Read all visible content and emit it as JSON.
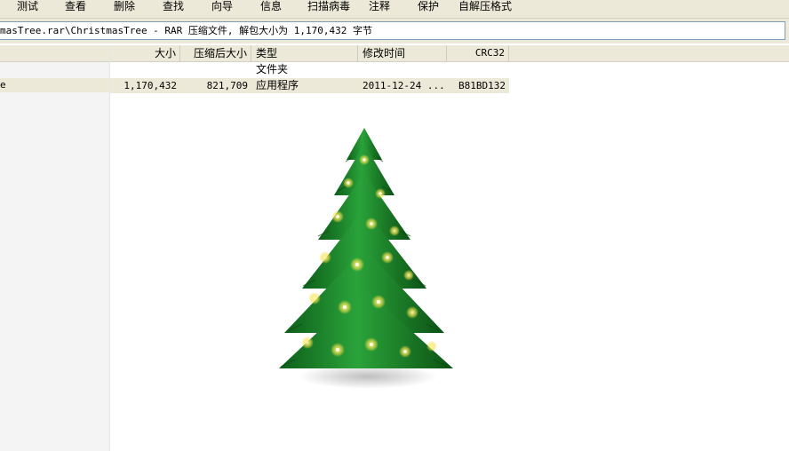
{
  "toolbar": {
    "buttons": [
      "测试",
      "查看",
      "删除",
      "查找",
      "向导",
      "信息",
      "扫描病毒",
      "注释",
      "保护",
      "自解压格式"
    ]
  },
  "address": {
    "path": "masTree.rar\\ChristmasTree - RAR 压缩文件, 解包大小为 1,170,432 字节"
  },
  "columns": {
    "size": "大小",
    "packed": "压缩后大小",
    "type": "类型",
    "modified": "修改时间",
    "crc": "CRC32"
  },
  "rows": [
    {
      "name": "",
      "size": "",
      "packed": "",
      "type": "文件夹",
      "modified": "",
      "crc": ""
    },
    {
      "name": "e",
      "size": "1,170,432",
      "packed": "821,709",
      "type": "应用程序",
      "modified": "2011-12-24 ...",
      "crc": "B81BD132"
    }
  ],
  "colors": {
    "toolbar_bg": "#ece9d8",
    "selected_row": "#ece9d8",
    "left_pane": "#f4f4f4",
    "tree_green": "#1f8a2a"
  },
  "icons": [
    "christmas-tree-image"
  ]
}
